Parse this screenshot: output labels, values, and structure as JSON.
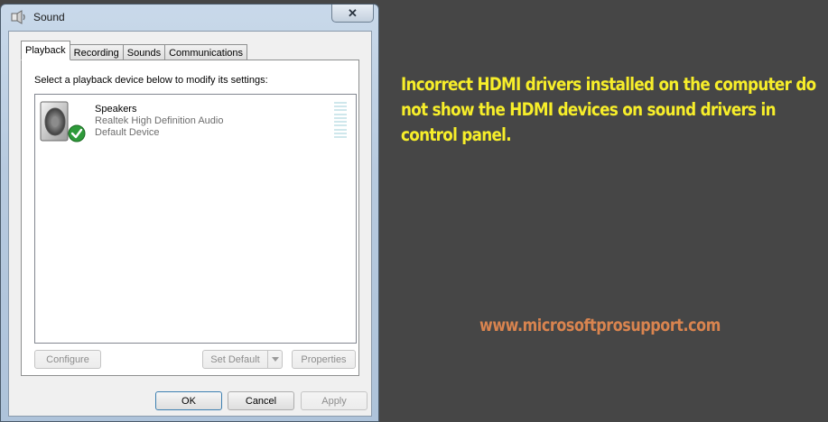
{
  "window": {
    "title": "Sound",
    "close_label": "✕"
  },
  "tabs": [
    {
      "label": "Playback",
      "active": true
    },
    {
      "label": "Recording",
      "active": false
    },
    {
      "label": "Sounds",
      "active": false
    },
    {
      "label": "Communications",
      "active": false
    }
  ],
  "playback": {
    "instruction": "Select a playback device below to modify its settings:",
    "devices": [
      {
        "name": "Speakers",
        "driver": "Realtek High Definition Audio",
        "status": "Default Device",
        "icon": "speaker-icon",
        "badge": "checkmark-icon"
      }
    ]
  },
  "buttons": {
    "configure": "Configure",
    "set_default": "Set Default",
    "properties": "Properties",
    "ok": "OK",
    "cancel": "Cancel",
    "apply": "Apply"
  },
  "caption": {
    "text": "Incorrect HDMI drivers installed on the computer do not show the HDMI devices on sound drivers in control panel.",
    "color": "#f7ee2a"
  },
  "site": {
    "text": "www.microsoftprosupport.com",
    "color": "#d9844f"
  }
}
